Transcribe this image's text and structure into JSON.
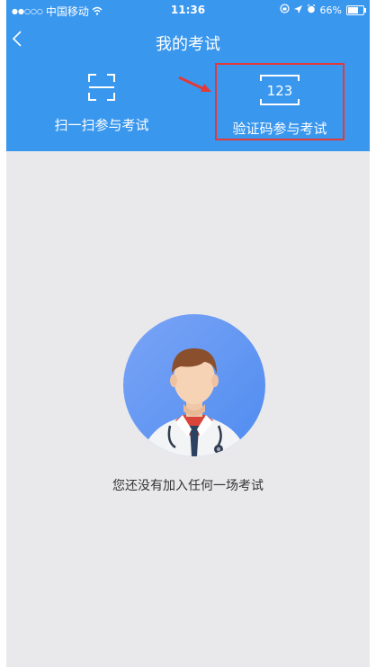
{
  "statusbar": {
    "carrier": "中国移动",
    "time": "11:36",
    "battery": "66%"
  },
  "navbar": {
    "title": "我的考试"
  },
  "actions": {
    "scan_label": "扫一扫参与考试",
    "code_label": "验证码参与考试",
    "code_icon_text": "123"
  },
  "empty": {
    "message": "您还没有加入任何一场考试"
  },
  "colors": {
    "header": "#3a97ee",
    "background": "#e9e9ec",
    "highlight": "#e23a3a"
  }
}
